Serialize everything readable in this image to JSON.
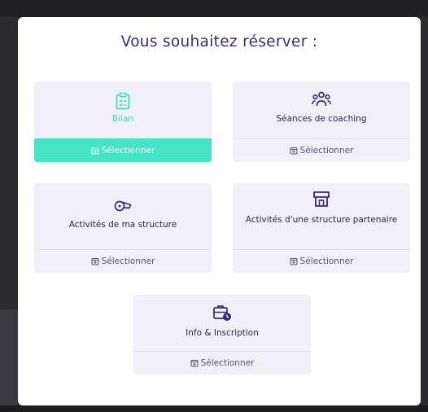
{
  "modal": {
    "title": "Vous souhaitez réserver :"
  },
  "cards": [
    {
      "name": "bilan",
      "label": "Bilan",
      "icon": "clipboard-icon",
      "button": "Sélectionner",
      "selected": true
    },
    {
      "name": "coaching",
      "label": "Séances de coaching",
      "icon": "group-icon",
      "button": "Sélectionner",
      "selected": false
    },
    {
      "name": "ma-structure",
      "label": "Activités de ma structure",
      "icon": "whistle-icon",
      "button": "Sélectionner",
      "selected": false
    },
    {
      "name": "structure-partenaire",
      "label": "Activités d'une structure partenaire",
      "icon": "store-icon",
      "button": "Sélectionner",
      "selected": false
    },
    {
      "name": "info-inscription",
      "label": "Info & Inscription",
      "icon": "briefcase-clock-icon",
      "button": "Sélectionner",
      "selected": false
    }
  ],
  "colors": {
    "accent": "#46e4c6",
    "title": "#3a2a6e",
    "card_background": "#f1eff7"
  }
}
